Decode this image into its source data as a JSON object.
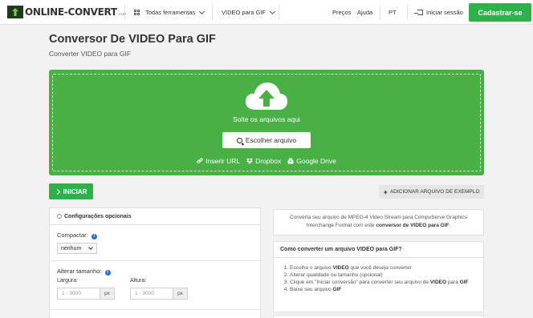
{
  "header": {
    "logo_text": "ONLINE-CONVERT",
    "logo_suffix": ".COM",
    "all_tools": "Todas ferramentas",
    "video_to_gif": "VIDEO para GIF",
    "prices": "Preços",
    "help": "Ajuda",
    "language": "PT",
    "sign_in": "Iniciar sessão",
    "sign_up": "Cadastrar-se"
  },
  "page": {
    "title": "Conversor De VIDEO Para GIF",
    "subtitle": "Converter VIDEO para GIF"
  },
  "dropzone": {
    "drop_text": "Solte os arquivos aqui",
    "choose_button": "Escolher arquivo",
    "sources": [
      {
        "label": "Inserir URL",
        "icon": "link-icon"
      },
      {
        "label": "Dropbox",
        "icon": "dropbox-icon"
      },
      {
        "label": "Google Drive",
        "icon": "google-drive-icon"
      }
    ]
  },
  "actions": {
    "start": "INICIAR",
    "add_sample": "ADICIONAR ARQUIVO DE EXEMPLO"
  },
  "settings": {
    "title": "Configurações opcionais",
    "compress_label": "Compactar:",
    "compress_value": "nenhum",
    "resize_label": "Alterar tamanho:",
    "width_label": "Largura:",
    "height_label": "Altura:",
    "width_placeholder": "1 - 3000",
    "height_placeholder": "1 - 3000",
    "unit": "px"
  },
  "description": {
    "text_before": "Converta seu arquivo de MPEG-4 Video Stream para CompuServe Graphics Interchange Format com este",
    "text_bold": "conversor de VIDEO para GIF",
    "text_after": "."
  },
  "howto": {
    "title": "Como converter um arquivo VIDEO para GIF?",
    "steps": [
      {
        "before": "Escolha o arquivo ",
        "bold": "VIDEO",
        "after": " que você deseja converter",
        "bold2": ""
      },
      {
        "before": "Alterar qualidade ou tamanho (opcional)",
        "bold": "",
        "after": "",
        "bold2": ""
      },
      {
        "before": "Clique em \"Iniciar conversão\" para converter seu arquivo de ",
        "bold": "VIDEO",
        "after": " para ",
        "bold2": "GIF"
      },
      {
        "before": "Baixe seu arquivo ",
        "bold": "GIF",
        "after": "",
        "bold2": ""
      }
    ]
  },
  "colors": {
    "brand_green": "#2db14a",
    "dropzone_green": "#48b044",
    "info_blue": "#2a6fd6"
  }
}
